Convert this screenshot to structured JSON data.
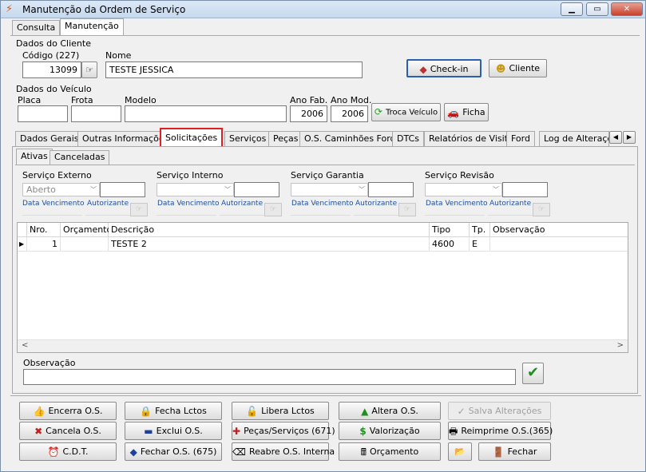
{
  "window": {
    "title": "Manutenção da Ordem de Serviço",
    "controls": {
      "minimize": "▭",
      "maximize": "▭",
      "close": "✕"
    }
  },
  "main_tabs": [
    "Consulta",
    "Manutenção"
  ],
  "cliente": {
    "group_label": "Dados do Cliente",
    "codigo_label": "Código (227)",
    "codigo_value": "13099",
    "nome_label": "Nome",
    "nome_value": "TESTE JESSICA",
    "checkin_label": "Check-in",
    "cliente_label": "Cliente"
  },
  "veiculo": {
    "group_label": "Dados do Veículo",
    "placa_label": "Placa",
    "frota_label": "Frota",
    "modelo_label": "Modelo",
    "ano_fab_label": "Ano Fab.",
    "ano_fab_value": "2006",
    "ano_mod_label": "Ano Mod.",
    "ano_mod_value": "2006",
    "troca_label": "Troca Veículo",
    "ficha_label": "Ficha"
  },
  "section_tabs": [
    "Dados Gerais",
    "Outras Informações",
    "Solicitações",
    "Serviços",
    "Peças",
    "O.S. Caminhões Ford",
    "DTCs",
    "Relatórios de Visita",
    "Ford",
    "Log de Alteraçõ"
  ],
  "sub_tabs": [
    "Ativas",
    "Canceladas"
  ],
  "servicos": [
    {
      "label": "Serviço Externo",
      "select": "Aberto"
    },
    {
      "label": "Serviço Interno",
      "select": ""
    },
    {
      "label": "Serviço Garantia",
      "select": ""
    },
    {
      "label": "Serviço Revisão",
      "select": ""
    }
  ],
  "data_vencimento_label": "Data Vencimento",
  "autorizante_label": "Autorizante",
  "grid": {
    "headers": [
      "Nro.",
      "Orçamento",
      "Descrição",
      "Tipo",
      "Tp.",
      "Observação"
    ],
    "rows": [
      {
        "nro": "1",
        "orcamento": "",
        "descricao": "TESTE 2",
        "tipo": "4600",
        "tp": "E",
        "obs": ""
      }
    ]
  },
  "observacao_label": "Observação",
  "actions": {
    "encerra": "Encerra O.S.",
    "fecha_lctos": "Fecha Lctos",
    "libera_lctos": "Libera Lctos",
    "altera": "Altera O.S.",
    "salva": "Salva Alterações",
    "cancela": "Cancela O.S.",
    "exclui": "Exclui O.S.",
    "pecas_servicos": "Peças/Serviços (671)",
    "valorizacao": "Valorização",
    "reimprime": "Reimprime O.S.(365)",
    "cdt": "C.D.T.",
    "fechar_os": "Fechar O.S. (675)",
    "reabre": "Reabre O.S. Interna",
    "orcamento": "Orçamento",
    "fechar": "Fechar"
  },
  "colors": {
    "highlight": "#e02020",
    "accent": "#1f4fa0"
  }
}
